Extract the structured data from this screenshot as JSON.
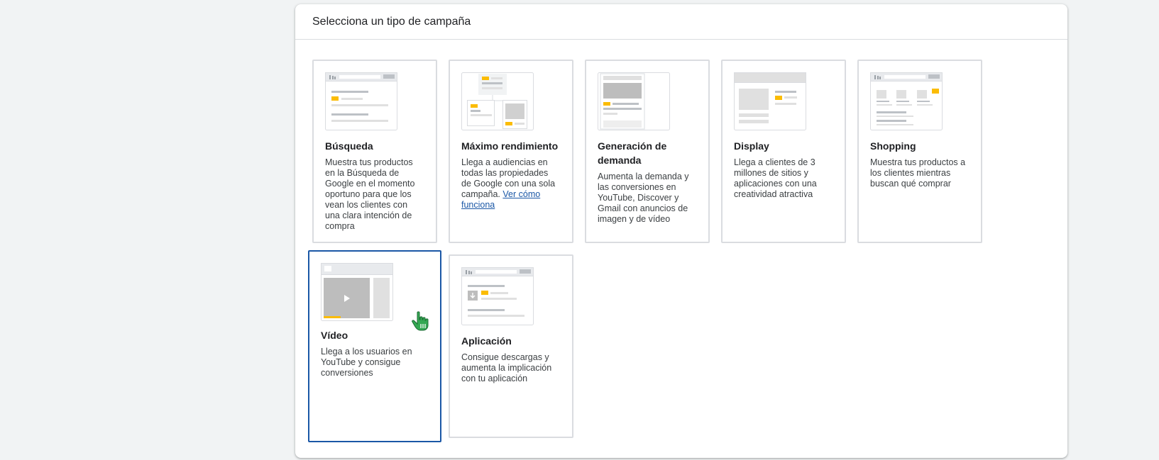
{
  "header": {
    "title": "Selecciona un tipo de campaña"
  },
  "cards": [
    {
      "id": "search",
      "title": "Búsqueda",
      "description": "Muestra tus productos en la Búsqueda de Google en el momento oportuno para que los vean los clientes con una clara intención de compra"
    },
    {
      "id": "pmax",
      "title": "Máximo rendimiento",
      "description": "Llega a audiencias en todas las propiedades de Google con una sola campaña.",
      "link": "Ver cómo funciona"
    },
    {
      "id": "demand",
      "title": "Generación de demanda",
      "description": "Aumenta la demanda y las conversiones en YouTube, Discover y Gmail con anuncios de imagen y de vídeo"
    },
    {
      "id": "display",
      "title": "Display",
      "description": "Llega a clientes de 3 millones de sitios y aplicaciones con una creatividad atractiva"
    },
    {
      "id": "shopping",
      "title": "Shopping",
      "description": "Muestra tus productos a los clientes mientras buscan qué comprar"
    },
    {
      "id": "video",
      "title": "Vídeo",
      "description": "Llega a los usuarios en YouTube y consigue conversiones",
      "selected": true
    },
    {
      "id": "app",
      "title": "Aplicación",
      "description": "Consigue descargas y aumenta la implicación con tu aplicación"
    }
  ],
  "colors": {
    "accent": "#fbbc04",
    "selected_border": "#1a57a6",
    "cursor": "#34a853"
  }
}
